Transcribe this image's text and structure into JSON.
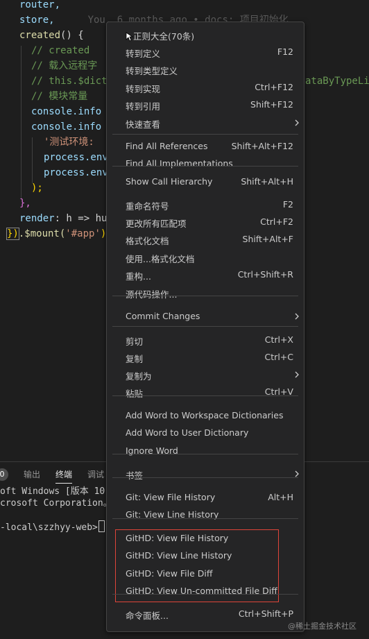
{
  "editor": {
    "lines": {
      "l1": "router,",
      "l2": "store,",
      "l2_blame": "You, 6 months ago • docs: 项目初始化",
      "l3_fn": "created",
      "l3_rest": "() {",
      "l4": "// created",
      "l5": "// 载入远程字",
      "l6": "// this.$dict",
      "l6_tail": "ataByTypeLi",
      "l7": "// 模块常量",
      "l8": "console.info",
      "l9": "console.info",
      "l10": "'测试环境:",
      "l11": "process.env",
      "l12": "process.env",
      "l13": ");",
      "l14": "},",
      "l15_key": "render",
      "l15_rest": ": h => hu",
      "l16_a": "})",
      "l16_b": ".$mount(",
      "l16_str": "'#app'",
      "l16_c": ")"
    }
  },
  "panel": {
    "badge": "0",
    "tabs": [
      "输出",
      "终端",
      "调试"
    ],
    "active_tab": "终端",
    "terminal_lines": [
      "oft Windows [版本 10.0",
      "crosoft Corporation。保",
      "-local\\szzhyy-web>"
    ]
  },
  "menu": {
    "items": [
      {
        "label": "正则大全(70条)",
        "key": "",
        "submenu": false,
        "icon": "pointer-cursor-icon"
      },
      {
        "label": "转到定义",
        "key": "F12",
        "submenu": false
      },
      {
        "label": "转到类型定义",
        "key": "",
        "submenu": false
      },
      {
        "label": "转到实现",
        "key": "Ctrl+F12",
        "submenu": false
      },
      {
        "label": "转到引用",
        "key": "Shift+F12",
        "submenu": false
      },
      {
        "label": "快速查看",
        "key": "",
        "submenu": true
      },
      {
        "label": "Find All References",
        "key": "Shift+Alt+F12",
        "submenu": false
      },
      {
        "label": "Find All Implementations",
        "key": "",
        "submenu": false
      },
      {
        "label": "Show Call Hierarchy",
        "key": "Shift+Alt+H",
        "submenu": false
      },
      {
        "label": "重命名符号",
        "key": "F2",
        "submenu": false
      },
      {
        "label": "更改所有匹配项",
        "key": "Ctrl+F2",
        "submenu": false
      },
      {
        "label": "格式化文档",
        "key": "Shift+Alt+F",
        "submenu": false
      },
      {
        "label": "使用...格式化文档",
        "key": "",
        "submenu": false
      },
      {
        "label": "重构...",
        "key": "Ctrl+Shift+R",
        "submenu": false
      },
      {
        "label": "源代码操作...",
        "key": "",
        "submenu": false
      },
      {
        "label": "Commit Changes",
        "key": "",
        "submenu": true
      },
      {
        "label": "剪切",
        "key": "Ctrl+X",
        "submenu": false
      },
      {
        "label": "复制",
        "key": "Ctrl+C",
        "submenu": false
      },
      {
        "label": "复制为",
        "key": "",
        "submenu": true
      },
      {
        "label": "粘贴",
        "key": "Ctrl+V",
        "submenu": false
      },
      {
        "label": "Add Word to Workspace Dictionaries",
        "key": "",
        "submenu": false
      },
      {
        "label": "Add Word to User Dictionary",
        "key": "",
        "submenu": false
      },
      {
        "label": "Ignore Word",
        "key": "",
        "submenu": false
      },
      {
        "label": "书签",
        "key": "",
        "submenu": true
      },
      {
        "label": "Git: View File History",
        "key": "Alt+H",
        "submenu": false
      },
      {
        "label": "Git: View Line History",
        "key": "",
        "submenu": false
      },
      {
        "label": "GitHD: View File History",
        "key": "",
        "submenu": false
      },
      {
        "label": "GitHD: View Line History",
        "key": "",
        "submenu": false
      },
      {
        "label": "GitHD: View File Diff",
        "key": "",
        "submenu": false
      },
      {
        "label": "GitHD: View Un-committed File Diff",
        "key": "",
        "submenu": false
      },
      {
        "label": "命令面板...",
        "key": "Ctrl+Shift+P",
        "submenu": false
      }
    ]
  },
  "watermark": "@稀土掘金技术社区",
  "colors": {
    "menu_bg": "#252526",
    "highlight_border": "#e0453a",
    "comment": "#6a9955",
    "string": "#ce9178"
  }
}
